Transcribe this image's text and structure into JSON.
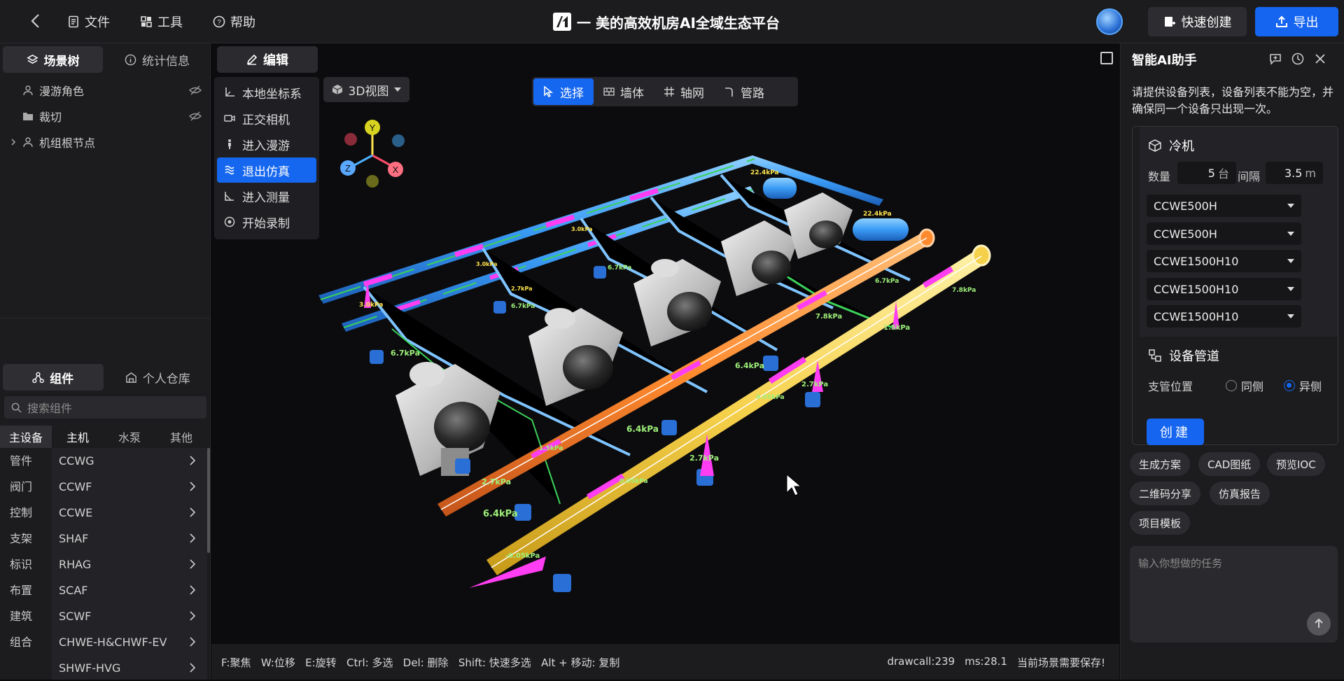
{
  "topbar": {
    "menus": [
      {
        "label": "文件",
        "icon": "file-icon"
      },
      {
        "label": "工具",
        "icon": "tools-icon"
      },
      {
        "label": "帮助",
        "icon": "help-icon"
      }
    ],
    "title": "一 美的高效机房AI全域生态平台",
    "quick_create": "快速创建",
    "export": "导出"
  },
  "left": {
    "tabs": [
      "场景树",
      "统计信息"
    ],
    "tree": [
      "漫游角色",
      "裁切",
      "机组根节点"
    ],
    "bottom_tabs": [
      "组件",
      "个人仓库"
    ],
    "search_placeholder": "搜索组件",
    "category_tabs": [
      "主设备",
      "主机",
      "水泵",
      "其他"
    ],
    "side_categories": [
      "管件",
      "阀门",
      "控制",
      "支架",
      "标识",
      "布置",
      "建筑",
      "组合"
    ],
    "models": [
      "CCWG",
      "CCWF",
      "CCWE",
      "SHAF",
      "RHAG",
      "SCAF",
      "SCWF",
      "CHWE-H&CHWF-EV",
      "SHWF-HVG"
    ]
  },
  "viewport": {
    "edit_label": "编辑",
    "menu": [
      {
        "label": "本地坐标系",
        "icon": "axis-icon"
      },
      {
        "label": "正交相机",
        "icon": "camera-icon"
      },
      {
        "label": "进入漫游",
        "icon": "person-walk-icon"
      },
      {
        "label": "退出仿真",
        "icon": "simulation-icon"
      },
      {
        "label": "进入测量",
        "icon": "ruler-icon"
      },
      {
        "label": "开始录制",
        "icon": "record-icon"
      }
    ],
    "view_label": "3D视图",
    "modes": [
      "选择",
      "墙体",
      "轴网",
      "管路"
    ],
    "axis_labels": {
      "y": "Y",
      "z": "Z",
      "x": "X"
    },
    "pressure_labels": [
      "22.4kPa",
      "22.4kPa",
      "3.0kPa",
      "3.0kPa",
      "3.0kPa",
      "2.7kPa",
      "6.7kPa",
      "6.7kPa",
      "6.7kPa",
      "6.7kPa",
      "7.8kPa",
      "7.8kPa",
      "1.5kPa",
      "6.4kPa",
      "2.7kPa",
      "6.4kPa",
      "2.7kPa",
      "6.4kPa",
      "2.7kPa",
      "1.5kPa",
      "0.05kPa",
      "0.05kPa",
      "-0.05kPa"
    ],
    "shortcuts": "F:聚焦   W:位移   E:旋转   Ctrl: 多选   Del: 删除   Shift: 快速多选   Alt + 移动: 复制",
    "drawcall": "drawcall:239",
    "ms": "ms:28.1",
    "save_notice": "当前场景需要保存!"
  },
  "assistant": {
    "title": "智能AI助手",
    "prompt": "请提供设备列表，设备列表不能为空，并确保同一个设备只出现一次。",
    "section_chiller": "冷机",
    "qty_label": "数量",
    "qty_value": "5",
    "qty_unit": "台",
    "gap_label": "间隔",
    "gap_value": "3.5",
    "gap_unit": "m",
    "models": [
      "CCWE500H",
      "CCWE500H",
      "CCWE1500H10",
      "CCWE1500H10",
      "CCWE1500H10"
    ],
    "section_pipe": "设备管道",
    "branch_label": "支管位置",
    "radio_same": "同侧",
    "radio_opposite": "异侧",
    "radio_selected": "异侧",
    "create": "创建",
    "chips": [
      "生成方案",
      "CAD图纸",
      "预览IOC",
      "二维码分享",
      "仿真报告",
      "项目模板"
    ],
    "task_placeholder": "输入你想做的任务"
  },
  "colors": {
    "accent": "#1667f0",
    "supply_pipe": "#4aa8ff",
    "orange_pipe": "#ff8a2e",
    "yellow_pipe": "#f5d04a",
    "magenta_arrow": "#ff3df2",
    "green_pipe": "#3bd15a"
  }
}
